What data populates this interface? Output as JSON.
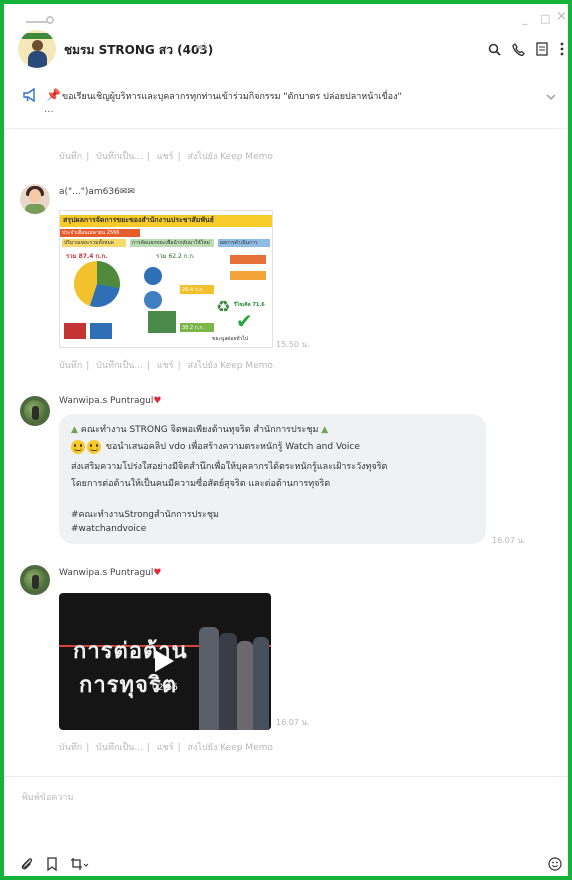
{
  "window": {
    "minimize_glyph": "_",
    "maximize_glyph": "□",
    "close_glyph": "×"
  },
  "chat": {
    "group_name": "ชมรม STRONG สว (403)",
    "mute_icon": "speaker-muted-icon",
    "header_icons": [
      "search-icon",
      "phone-icon",
      "notes-icon",
      "more-icon"
    ]
  },
  "announcement": {
    "text": "ขอเรียนเชิญผู้บริหารและบุคลากรทุกท่านเข้าร่วมกิจกรรม \"ตักบาตร ปล่อยปลาหน้าเขื่อง\"",
    "more": "..."
  },
  "message_actions": [
    "บันทึก",
    "บันทึกเป็น...",
    "แชร์",
    "ส่งไปยัง Keep Memo"
  ],
  "messages": [
    {
      "sender": "a(\"...\")am636✉✉",
      "type": "image",
      "infographic": {
        "title": "สรุปผลการจัดการขยะของสำนักงานประชาสัมพันธ์",
        "subtitle": "ประจำเดือนเมษายน 2566",
        "col1": "ปริมาณขยะรวมทั้งหมด",
        "col2": "การคัดแยกขยะเพื่อนำกลับมาใช้ใหม่",
        "col3": "ผลการดำเนินการ",
        "amount_left": "รวม 87.4 ก.ก.",
        "amount_mid": "รวม 62.2 ก.ก.",
        "value1": "26.4 ก.ก.",
        "value2": "38.2 ก.ก.",
        "recycle_label": "รีไซเคิล 71.6",
        "footer": "ขยะมูลฝอยทั่วไป"
      },
      "time": "15.50 น."
    },
    {
      "sender": "Wanwipa.s Puntragul",
      "type": "text",
      "lines": [
        "คณะทำงาน STRONG จิตพอเพียงต้านทุจริต สำนักการประชุม",
        "ขอนำเสนอคลิป vdo  เพื่อสร้างความตระหนักรู้ Watch and Voice",
        "ส่งเสริมความโปร่งใสอย่างมีจิตสำนึกเพื่อให้บุคลากรได้ตระหนักรู้และเฝ้าระวังทุจริต",
        "โดยการต่อต้านให้เป็นคนมีความซื่อสัตย์สุจริต  และต่อต้านการทุจริต",
        "#คณะทำงานStrongสำนักการประชุม",
        "#watchandvoice"
      ],
      "time": "16.07 น."
    },
    {
      "sender": "Wanwipa.s Puntragul",
      "type": "video",
      "title_line1": "การต่อต้าน",
      "title_line2": "การทุจริต",
      "duration": "02:55",
      "time": "16.07 น."
    }
  ],
  "composer": {
    "placeholder": "พิมพ์ข้อความ",
    "tools": [
      "paperclip-icon",
      "bookmark-icon",
      "crop-icon",
      "emoji-icon"
    ]
  }
}
